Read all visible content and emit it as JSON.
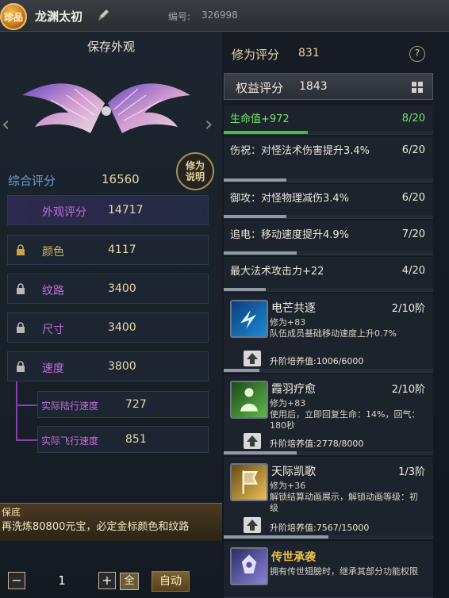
{
  "header": {
    "rarity": "珍品",
    "name": "龙渊太初",
    "serial_label": "编号:",
    "serial": "326998"
  },
  "left": {
    "appearance_title": "保存外观",
    "info_button": "修为说明",
    "total_label": "综合评分",
    "total_value": "16560",
    "stats": [
      {
        "label": "外观评分",
        "value": "14717"
      },
      {
        "label": "颜色",
        "value": "4117"
      },
      {
        "label": "纹路",
        "value": "3400"
      },
      {
        "label": "尺寸",
        "value": "3400"
      },
      {
        "label": "速度",
        "value": "3800"
      }
    ],
    "sub_stats": [
      {
        "label": "实际陆行速度",
        "value": "727"
      },
      {
        "label": "实际飞行速度",
        "value": "851"
      }
    ],
    "guarantee_title": "保底",
    "guarantee_text": "再洗炼80800元宝，必定金标颜色和纹路",
    "quantity": "1",
    "minus": "−",
    "plus": "+",
    "all": "全",
    "auto": "自动"
  },
  "right": {
    "cult_title": "修为评分",
    "cult_value": "831",
    "help": "?",
    "rights_title": "权益评分",
    "rights_value": "1843",
    "attributes": [
      {
        "text": "生命值+972",
        "count": "8/20",
        "progress": 0.4,
        "green": true
      },
      {
        "text": "伤祝：对怪法术伤害提升3.4%",
        "count": "6/20",
        "progress": 0.3
      },
      {
        "text": "御攻：对怪物理减伤3.4%",
        "count": "6/20",
        "progress": 0.3
      },
      {
        "text": "追电：移动速度提升4.9%",
        "count": "7/20",
        "progress": 0.35
      },
      {
        "text": "最大法术攻击力+22",
        "count": "4/20",
        "progress": 0.2
      }
    ],
    "skills": [
      {
        "name": "电芒共逐",
        "level": "2/10阶",
        "desc1": "修为+83",
        "desc2": "队伍成员基础移动速度上升0.7%",
        "upgrade": "升阶培养值:1006/6000",
        "progress": 0.17
      },
      {
        "name": "霞羽疗愈",
        "level": "2/10阶",
        "desc1": "修为+83",
        "desc2": "使用后，立即回复生命：14%，回气：180秒",
        "upgrade": "升阶培养值:2778/8000",
        "progress": 0.35
      },
      {
        "name": "天际凯歌",
        "level": "1/3阶",
        "desc1": "修为+36",
        "desc2": "解锁结算动画展示，解锁动画等级：初级",
        "upgrade": "升阶培养值:7567/15000",
        "progress": 0.5
      }
    ],
    "legacy": {
      "name": "传世承袭",
      "desc": "拥有传世翅膀时，继承其部分功能权限"
    }
  },
  "colors": {
    "accent_gold": "#e6d9a6",
    "purple": "#c16ed8",
    "green": "#6fe56a",
    "blue": "#6aa4d3"
  }
}
